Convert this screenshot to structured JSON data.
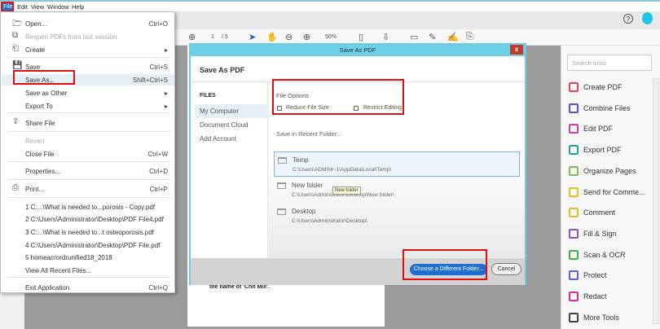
{
  "menubar": {
    "items": [
      "File",
      "Edit",
      "View",
      "Window",
      "Help"
    ]
  },
  "toolbar": {
    "page_current": "1",
    "page_total": "/ 5",
    "zoom": "50%"
  },
  "file_menu": {
    "items": [
      {
        "label": "Open...",
        "shortcut": "Ctrl+O",
        "icon": "folder-open-icon"
      },
      {
        "label": "Reopen PDFs from last session",
        "disabled": true,
        "icon": "reopen-icon"
      },
      {
        "label": "Create",
        "submenu": true,
        "icon": "create-icon"
      },
      {
        "label": "Save",
        "shortcut": "Ctrl+S",
        "icon": "save-icon"
      },
      {
        "label": "Save As...",
        "shortcut": "Shift+Ctrl+S",
        "highlighted": true
      },
      {
        "label": "Save as Other",
        "submenu": true
      },
      {
        "label": "Export To",
        "submenu": true
      },
      {
        "label": "Share File",
        "icon": "share-icon"
      },
      {
        "label": "Revert",
        "disabled": true
      },
      {
        "label": "Close File",
        "shortcut": "Ctrl+W"
      },
      {
        "label": "Properties...",
        "shortcut": "Ctrl+D"
      },
      {
        "label": "Print...",
        "shortcut": "Ctrl+P",
        "icon": "print-icon"
      },
      {
        "label": "1 C:...\\What is needed to...porosis - Copy.pdf"
      },
      {
        "label": "2 C:\\Users\\Administrator\\Desktop\\PDF File4.pdf"
      },
      {
        "label": "3 C:...\\What is needed to...t osteoporosis.pdf"
      },
      {
        "label": "4 C:\\Users\\Administrator\\Desktop\\PDF File.pdf"
      },
      {
        "label": "5 homeacrordrunified18_2018"
      },
      {
        "label": "View All Recent Files..."
      },
      {
        "label": "Exit Application",
        "shortcut": "Ctrl+Q"
      }
    ]
  },
  "dialog": {
    "title": "Save As PDF",
    "heading": "Save As PDF",
    "files_label": "FILES",
    "nav": [
      "My Computer",
      "Document Cloud",
      "Add Account"
    ],
    "file_options_label": "File Options",
    "options": [
      {
        "label": "Reduce File Size",
        "checked": false
      },
      {
        "label": "Restrict Editing",
        "checked": false
      }
    ],
    "recent_label": "Save in Recent Folder...",
    "folders": [
      {
        "name": "Temp",
        "path": "C:\\Users\\ADMINI~1\\AppData\\Local\\Temp\\",
        "selected": true
      },
      {
        "name": "New folder",
        "path": "C:\\Users\\Administrator\\Desktop\\New folder\\"
      },
      {
        "name": "Desktop",
        "path": "C:\\Users\\Administrator\\Desktop\\"
      }
    ],
    "tooltip": "New folder",
    "choose_button": "Choose a Different Folder...",
    "cancel_button": "Cancel",
    "close": "x"
  },
  "document": {
    "text": "the name of 'Chit Mill'."
  },
  "tools": {
    "search_placeholder": "Search tools",
    "items": [
      {
        "label": "Create PDF",
        "color": "#e0455a"
      },
      {
        "label": "Combine Files",
        "color": "#5a4fd8"
      },
      {
        "label": "Edit PDF",
        "color": "#d5409a"
      },
      {
        "label": "Export PDF",
        "color": "#2aa48f"
      },
      {
        "label": "Organize Pages",
        "color": "#7cc24a"
      },
      {
        "label": "Send for Comme...",
        "color": "#e0c020"
      },
      {
        "label": "Comment",
        "color": "#e0c020"
      },
      {
        "label": "Fill & Sign",
        "color": "#8a4fd8"
      },
      {
        "label": "Scan & OCR",
        "color": "#3bb54a"
      },
      {
        "label": "Protect",
        "color": "#5a5fd8"
      },
      {
        "label": "Redact",
        "color": "#d5308a"
      },
      {
        "label": "More Tools",
        "color": "#444"
      }
    ]
  },
  "colors": {
    "accent": "#1a73c9",
    "dialog_title": "#6dcfe6",
    "highlight": "#e01010"
  }
}
